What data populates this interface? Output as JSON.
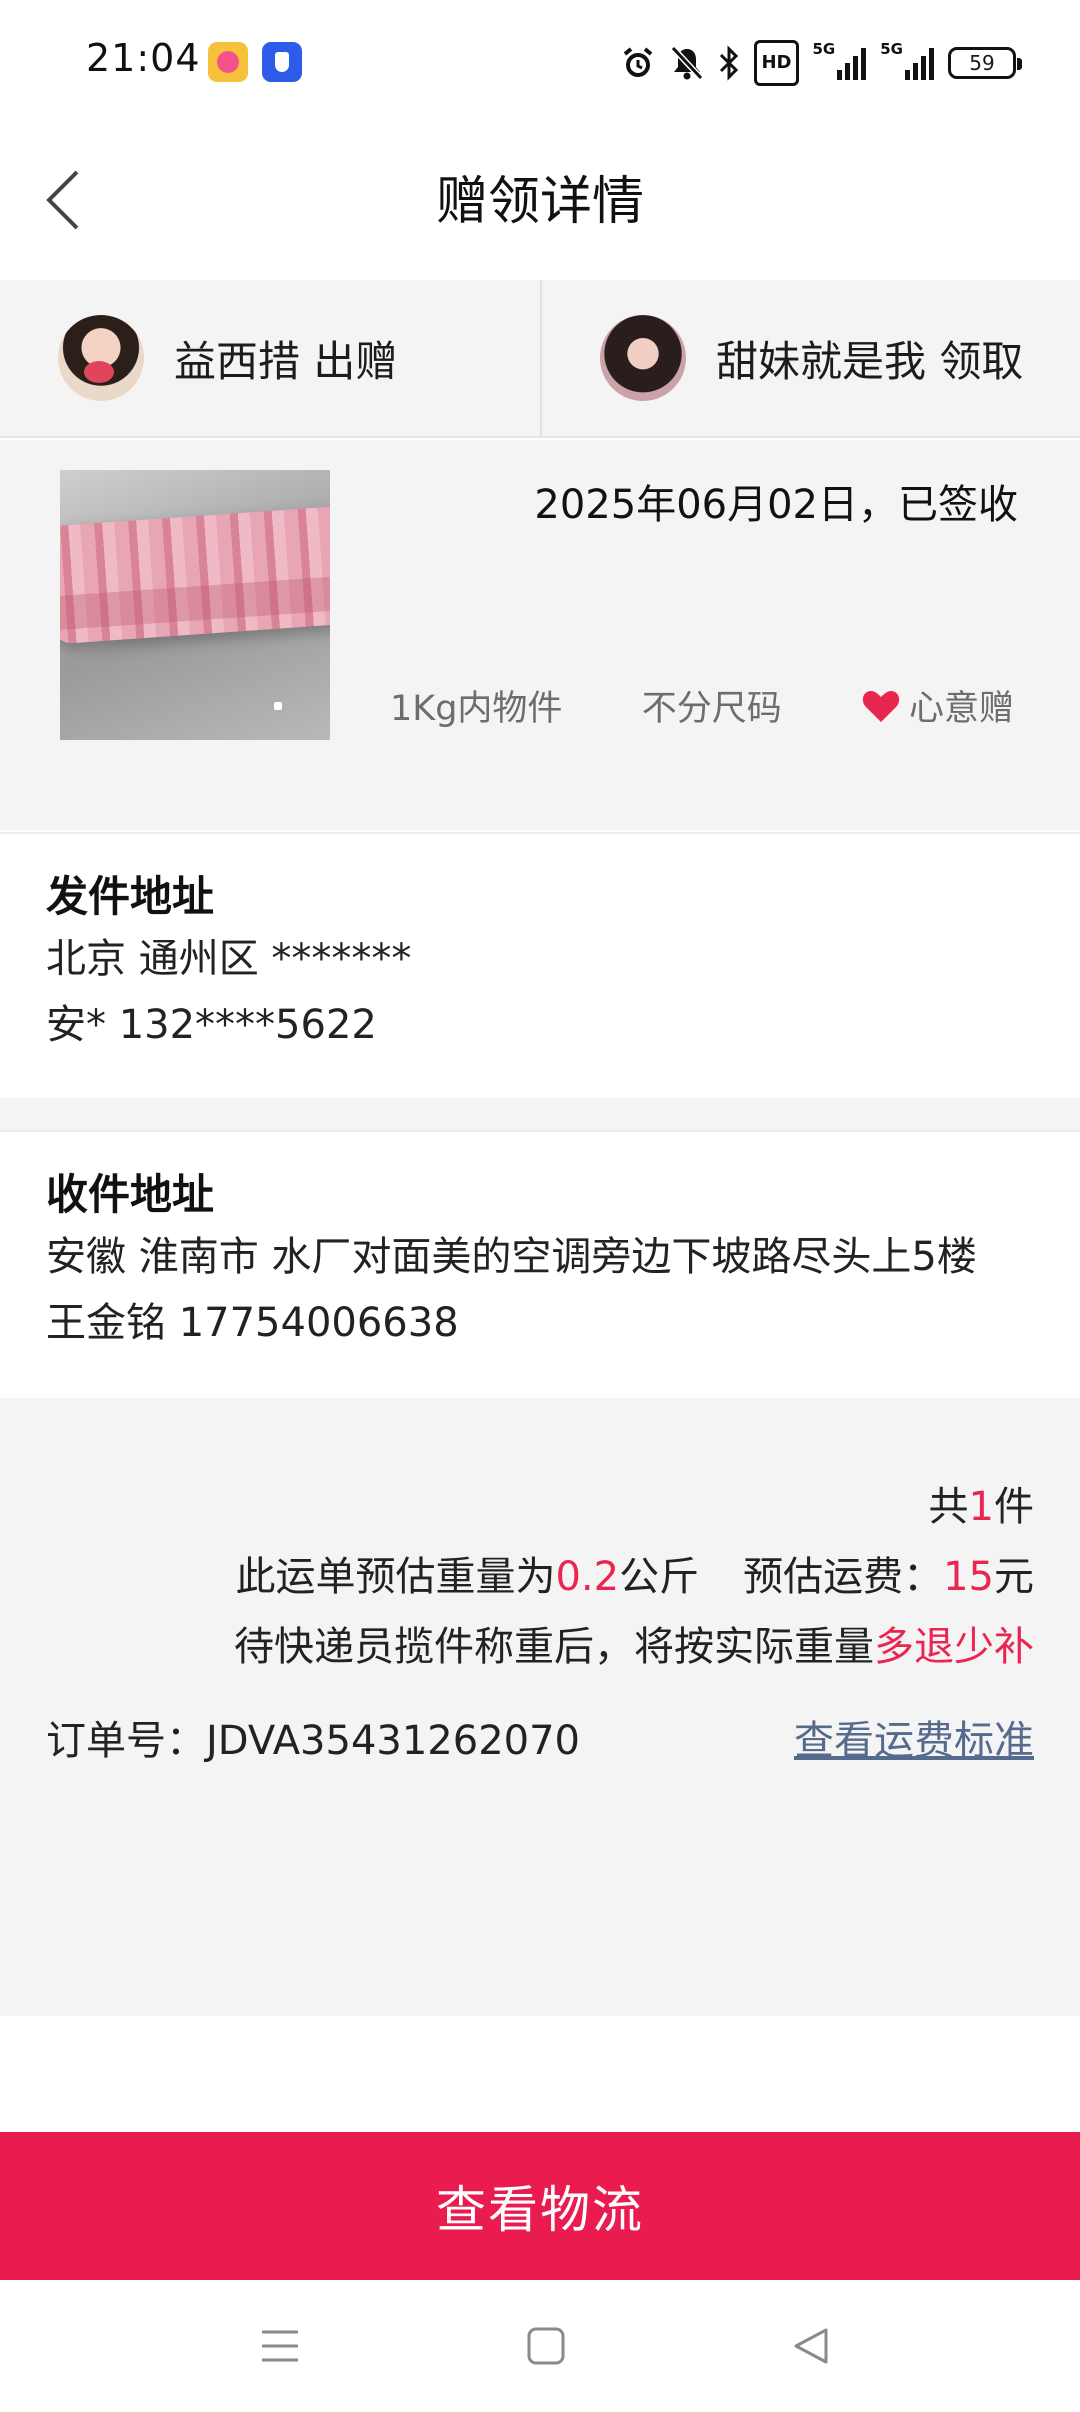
{
  "status_bar": {
    "time": "21:04",
    "battery": "59",
    "icons": [
      "alarm-icon",
      "mute-icon",
      "bluetooth-icon",
      "hd-icon",
      "5g-signal-icon",
      "5g-signal-icon",
      "battery-icon"
    ],
    "hd_label": "HD",
    "net1": "5G",
    "net2": "5G"
  },
  "header": {
    "title": "赠领详情"
  },
  "people": {
    "giver": "益西措 出赠",
    "receiver": "甜妹就是我 领取"
  },
  "item": {
    "date_status": "2025年06月02日，已签收",
    "tags": [
      "1Kg内物件",
      "不分尺码"
    ],
    "heart_label": "心意赠",
    "heart_color": "#e8264f"
  },
  "send_address": {
    "title": "发件地址",
    "line1": "北京 通州区 *******",
    "line2": "安* 132****5622"
  },
  "recv_address": {
    "title": "收件地址",
    "line1": "安徽 淮南市 水厂对面美的空调旁边下坡路尽头上5楼",
    "line2": "王金铭 17754006638"
  },
  "freight": {
    "count_prefix": "共",
    "count_value": "1",
    "count_suffix": "件",
    "weight_prefix": "此运单预估重量为",
    "weight_value": "0.2",
    "weight_unit": "公斤",
    "fee_label": "预估运费：",
    "fee_value": "15",
    "fee_unit": "元",
    "note_prefix": "待快递员揽件称重后，将按实际重量",
    "note_highlight": "多退少补",
    "order_label": "订单号：JDVA35431262070",
    "fee_standard_link": "查看运费标准",
    "accent_color": "#e8264f"
  },
  "actions": {
    "logistics_button": "查看物流",
    "button_color": "#ea1c4f"
  }
}
